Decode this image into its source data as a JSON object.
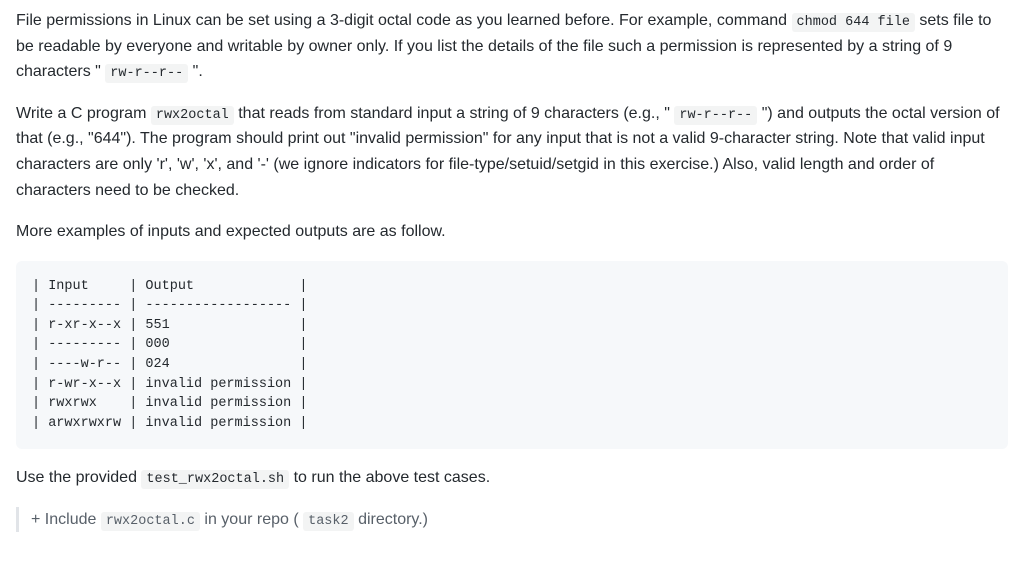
{
  "para1": {
    "t1": "File permissions in Linux can be set using a 3-digit octal code as you learned before. For example, command ",
    "c1": "chmod 644 file",
    "t2": " sets file to be readable by everyone and writable by owner only. If you list the details of the file such a permission is represented by a string of 9 characters \" ",
    "c2": "rw-r--r--",
    "t3": " \"."
  },
  "para2": {
    "t1": "Write a C program ",
    "c1": "rwx2octal",
    "t2": " that reads from standard input a string of 9 characters (e.g., \" ",
    "c2": "rw-r--r--",
    "t3": " \") and outputs the octal version of that (e.g., \"644\"). The program should print out \"invalid permission\" for any input that is not a valid 9-character string. Note that valid input characters are only 'r', 'w', 'x', and '-' (we ignore indicators for file-type/setuid/setgid in this exercise.) Also, valid length and order of characters need to be checked."
  },
  "para3": "More examples of inputs and expected outputs are as follow.",
  "examples": "| Input     | Output             |\n| --------- | ------------------ |\n| r-xr-x--x | 551                |\n| --------- | 000                |\n| ----w-r-- | 024                |\n| r-wr-x--x | invalid permission |\n| rwxrwx    | invalid permission |\n| arwxrwxrw | invalid permission |",
  "para4": {
    "t1": "Use the provided ",
    "c1": "test_rwx2octal.sh",
    "t2": " to run the above test cases."
  },
  "deliverable": {
    "t1": "+ Include ",
    "c1": "rwx2octal.c",
    "t2": " in your repo ( ",
    "c2": "task2",
    "t3": " directory.)"
  }
}
